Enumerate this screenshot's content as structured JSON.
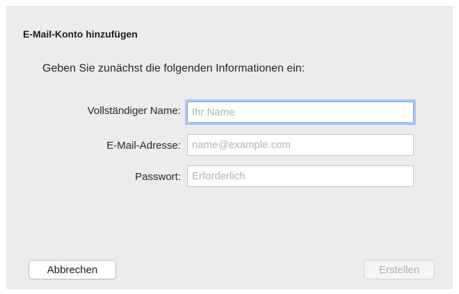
{
  "dialog": {
    "title": "E-Mail-Konto hinzufügen",
    "subtitle": "Geben Sie zunächst die folgenden Informationen ein:",
    "fields": {
      "name": {
        "label": "Vollständiger Name:",
        "value": "",
        "placeholder": "Ihr Name",
        "focused": true
      },
      "email": {
        "label": "E-Mail-Adresse:",
        "value": "",
        "placeholder": "name@example.com"
      },
      "password": {
        "label": "Passwort:",
        "value": "",
        "placeholder": "Erforderlich"
      }
    },
    "buttons": {
      "cancel_label": "Abbrechen",
      "create_label": "Erstellen",
      "create_enabled": false
    },
    "colors": {
      "focus_ring": "#a9c8f2",
      "background": "#ececec"
    }
  }
}
